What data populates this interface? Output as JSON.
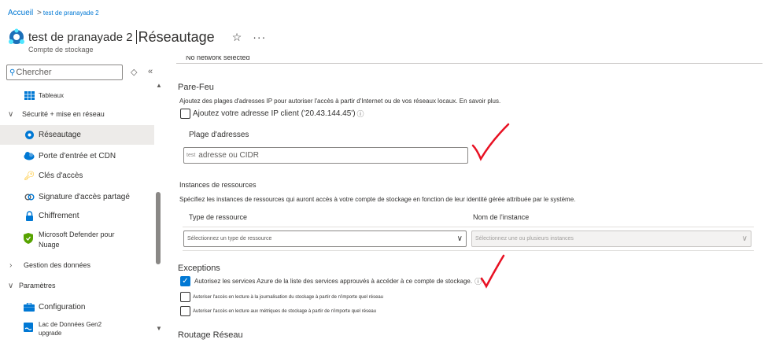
{
  "breadcrumb": {
    "home": "Accueil",
    "sep": ">",
    "current": "test de pranayade 2"
  },
  "header": {
    "resource_name": "test de pranayade 2",
    "page_title": "Réseautage",
    "subtitle": "Compte de stockage",
    "star": "☆",
    "more": "···"
  },
  "sidebar": {
    "search_placeholder": "Chercher",
    "items": [
      {
        "label": "Tableaux"
      },
      {
        "label": "Sécurité + mise en réseau"
      },
      {
        "label": "Réseautage"
      },
      {
        "label": "Porte d'entrée et CDN"
      },
      {
        "label": "Clés d'accès"
      },
      {
        "label": "Signature d'accès partagé"
      },
      {
        "label": "Chiffrement"
      },
      {
        "label": "Microsoft Defender pour Nuage"
      },
      {
        "label": "Gestion des données"
      },
      {
        "label": "Paramètres"
      },
      {
        "label": "Configuration"
      },
      {
        "label": "Lac de Données Gen2 upgrade"
      }
    ]
  },
  "main": {
    "cutoff_top": "No network selected",
    "firewall": {
      "title": "Pare-Feu",
      "description": "Ajoutez des plages d'adresses IP pour autoriser l'accès à partir d'Internet ou de vos réseaux locaux. En savoir plus.",
      "add_client_ip": "Ajoutez votre adresse IP client ('20.43.144.45')",
      "range_label": "Plage d'adresses",
      "range_placeholder": "adresse ou CIDR",
      "range_prefix": "test"
    },
    "instances": {
      "title": "Instances de ressources",
      "description": "Spécifiez les instances de ressources qui auront accès à votre compte de stockage en fonction de leur identité gérée attribuée par le système.",
      "col_type": "Type de ressource",
      "col_name": "Nom de l'instance",
      "type_placeholder": "Sélectionnez un type de ressource",
      "name_placeholder": "Sélectionnez une ou plusieurs instances"
    },
    "exceptions": {
      "title": "Exceptions",
      "items": [
        {
          "label": "Autorisez les services Azure de la liste des services approuvés à accéder à ce compte de stockage.",
          "checked": true
        },
        {
          "label": "Autoriser l'accès en lecture à la journalisation du stockage à partir de n'importe quel réseau",
          "checked": false
        },
        {
          "label": "Autoriser l'accès en lecture aux métriques de stockage à partir de n'importe quel réseau",
          "checked": false
        }
      ]
    },
    "routing": {
      "title": "Routage Réseau"
    }
  },
  "colors": {
    "accent": "#0078d4",
    "annotation": "#e81123"
  }
}
